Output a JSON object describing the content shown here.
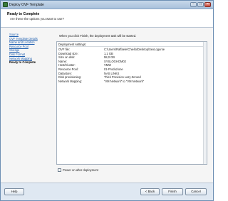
{
  "window": {
    "title": "Deploy OVF Template",
    "minimize_glyph": "–",
    "maximize_glyph": "□",
    "close_glyph": "×"
  },
  "header": {
    "title": "Ready to Complete",
    "subtitle": "Are these the options you want to use?"
  },
  "nav": {
    "items": [
      {
        "label": "Source"
      },
      {
        "label": "OVF Template Details"
      },
      {
        "label": "Name and Location"
      },
      {
        "label": "Resource Pool"
      },
      {
        "label": "Storage"
      },
      {
        "label": "Disk Format"
      },
      {
        "label": "Network Mapping"
      },
      {
        "label": "Ready to Complete"
      }
    ],
    "current_index": 7
  },
  "main": {
    "intro": "When you click Finish, the deployment task will be started.",
    "settings_title": "Deployment settings:",
    "settings": [
      {
        "label": "OVF file:",
        "value": "C:\\Users\\Raffaele\\Chiello\\Desktop\\SexLogurse"
      },
      {
        "label": "Download size:",
        "value": "1,1 GB"
      },
      {
        "label": "Size on disk:",
        "value": "58,0 GB"
      },
      {
        "label": "Name:",
        "value": "SYSLOGHOM02"
      },
      {
        "label": "Host/Cluster:",
        "value": "VMW"
      },
      {
        "label": "Resource Pool:",
        "value": "01-Produzione"
      },
      {
        "label": "Datastore:",
        "value": "NAS          LINKS"
      },
      {
        "label": "Disk provisioning:",
        "value": "Thick Provision Lazy Zeroed"
      },
      {
        "label": "Network Mapping:",
        "value": "\"VM Network\" to \"VM Network\""
      }
    ],
    "power_on_label": "Power on after deployment",
    "power_on_checked": false
  },
  "footer": {
    "help": "Help",
    "back": "< Back",
    "finish": "Finish",
    "cancel": "Cancel"
  }
}
